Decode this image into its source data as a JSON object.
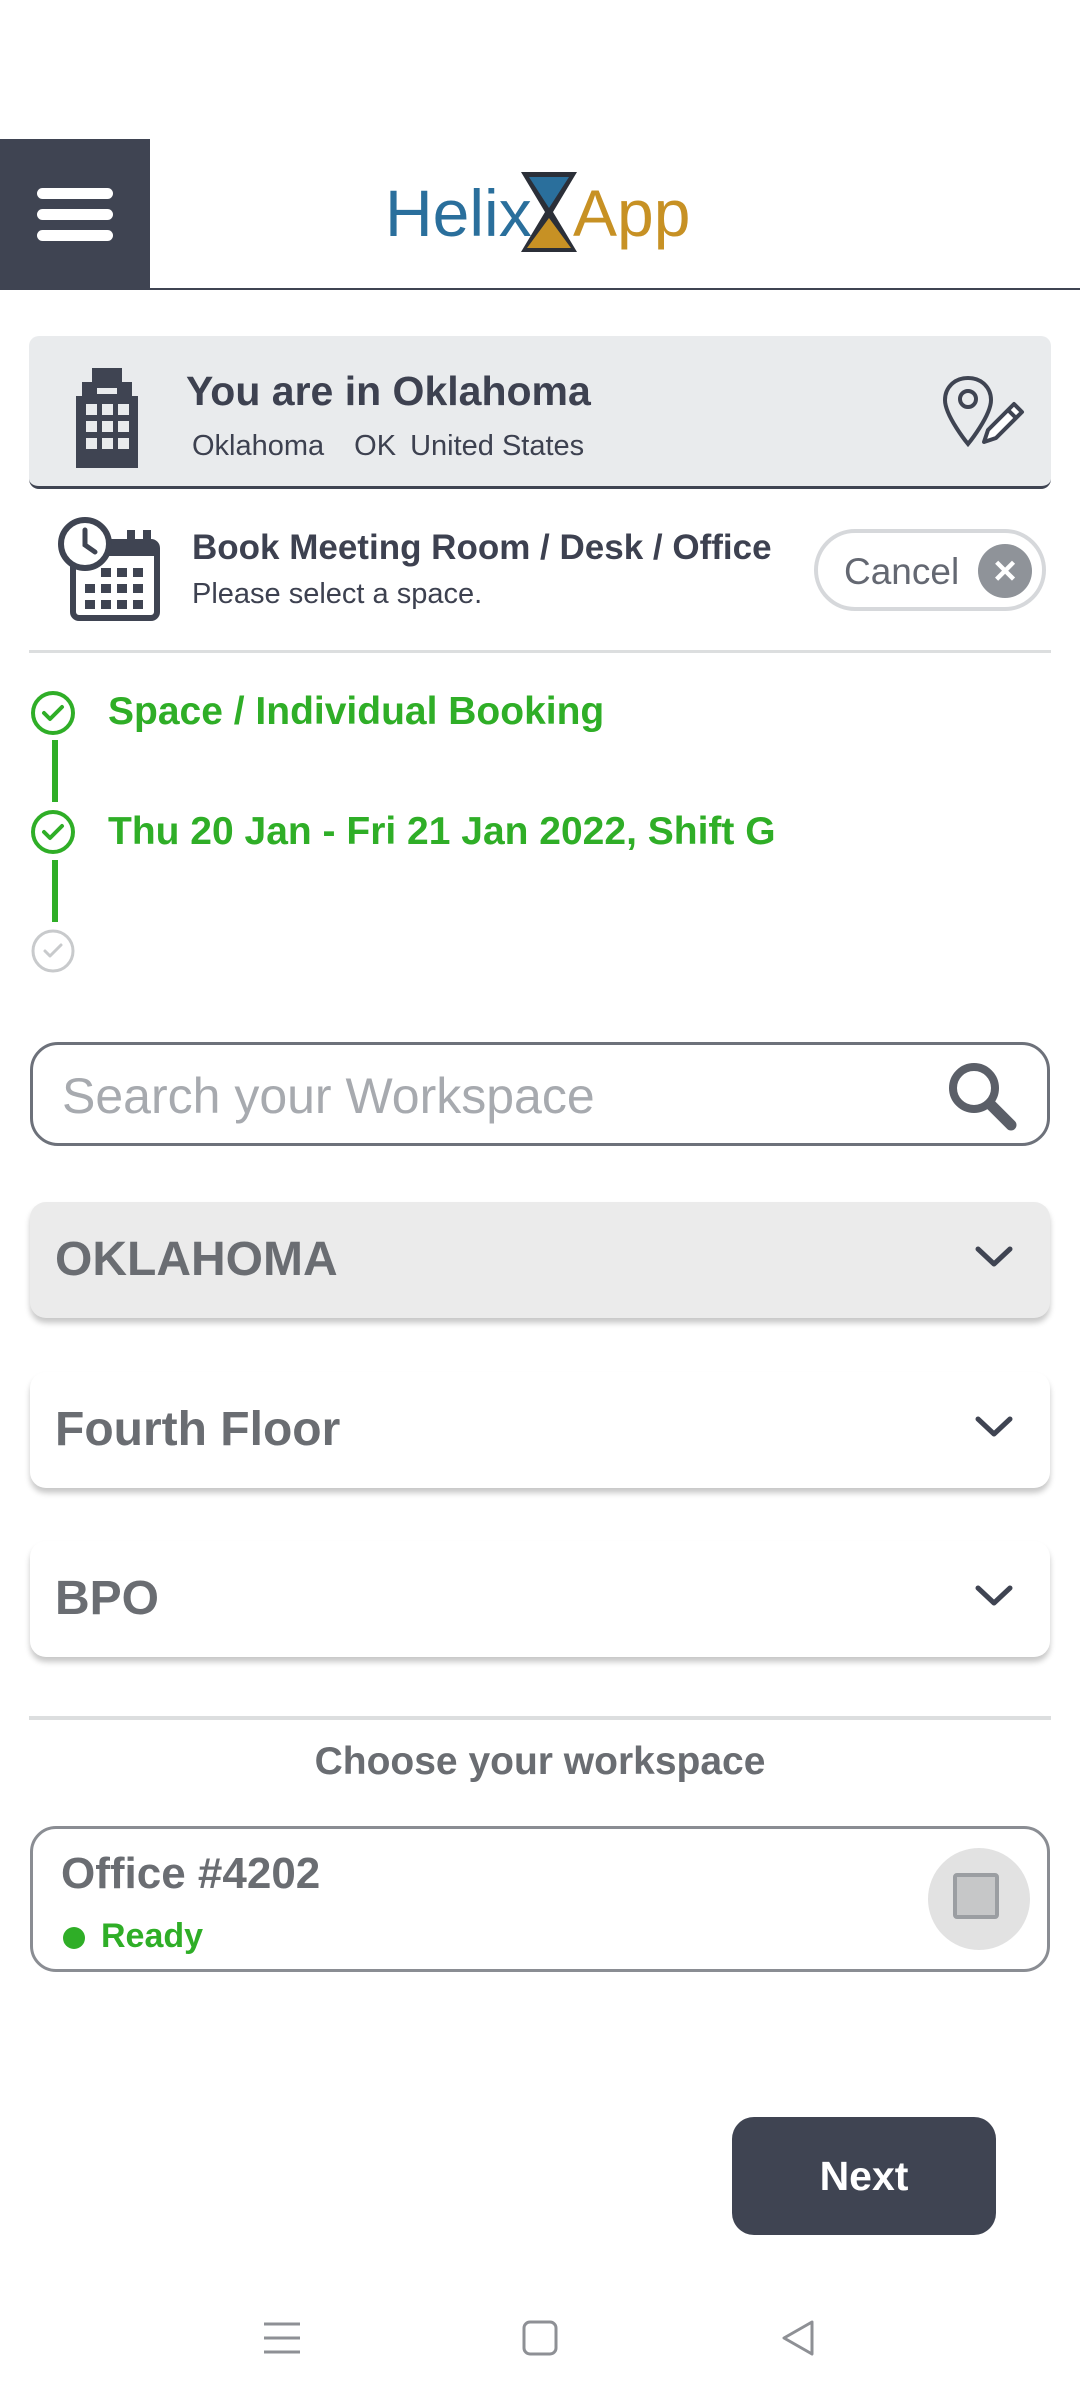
{
  "header": {
    "logo_left": "Helix",
    "logo_right": "App"
  },
  "location": {
    "title": "You are in Oklahoma",
    "city": "Oklahoma",
    "state": "OK",
    "country": "United States"
  },
  "booking": {
    "title": "Book Meeting Room / Desk / Office",
    "subtitle": "Please select a space.",
    "cancel_label": "Cancel"
  },
  "steps": [
    {
      "label": "Space / Individual Booking",
      "done": true
    },
    {
      "label": "Thu 20 Jan - Fri 21 Jan 2022, Shift G",
      "done": true
    },
    {
      "label": "",
      "done": false
    }
  ],
  "search": {
    "placeholder": "Search your Workspace",
    "value": ""
  },
  "filters": [
    {
      "label": "OKLAHOMA"
    },
    {
      "label": "Fourth Floor"
    },
    {
      "label": "BPO"
    }
  ],
  "workspace": {
    "heading": "Choose your workspace",
    "items": [
      {
        "name": "Office #4202",
        "status": "Ready",
        "checked": false
      }
    ]
  },
  "next_label": "Next",
  "colors": {
    "dark": "#3f4452",
    "green": "#2fae27",
    "logo_blue": "#2a6f9c",
    "logo_gold": "#c79124"
  }
}
